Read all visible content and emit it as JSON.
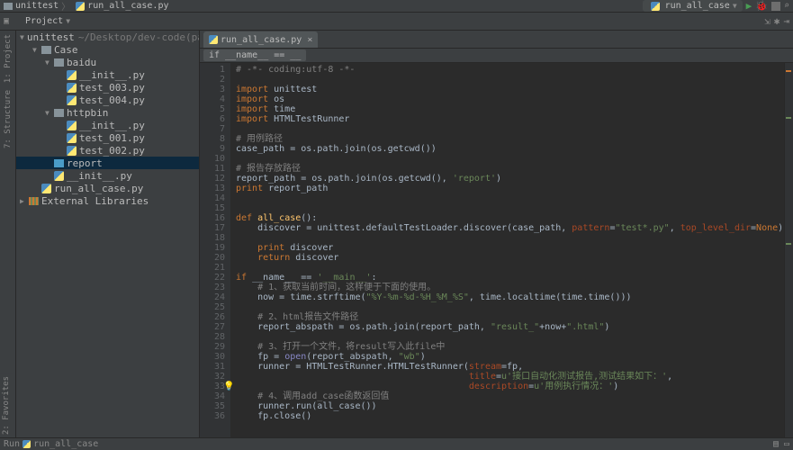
{
  "titlebar": {
    "project": "unittest",
    "file_icon": "python-icon",
    "filename": "run_all_case.py",
    "run_config": "run_all_case"
  },
  "toolbar": {
    "project_label": "Project"
  },
  "left_gutter": {
    "tabs": [
      "1: Project",
      "7: Structure"
    ]
  },
  "tree": {
    "root": {
      "name": "unittest",
      "path": "~/Desktop/dev-code(pa)/lear"
    },
    "items": [
      {
        "indent": 0,
        "arrow": "▼",
        "icon": "folder",
        "label": "unittest",
        "dim": "~/Desktop/dev-code(pa)/lear"
      },
      {
        "indent": 1,
        "arrow": "▼",
        "icon": "folder",
        "label": "Case"
      },
      {
        "indent": 2,
        "arrow": "▼",
        "icon": "folder",
        "label": "baidu"
      },
      {
        "indent": 3,
        "arrow": "",
        "icon": "py",
        "label": "__init__.py"
      },
      {
        "indent": 3,
        "arrow": "",
        "icon": "py",
        "label": "test_003.py"
      },
      {
        "indent": 3,
        "arrow": "",
        "icon": "py",
        "label": "test_004.py"
      },
      {
        "indent": 2,
        "arrow": "▼",
        "icon": "folder",
        "label": "httpbin"
      },
      {
        "indent": 3,
        "arrow": "",
        "icon": "py",
        "label": "__init__.py"
      },
      {
        "indent": 3,
        "arrow": "",
        "icon": "py",
        "label": "test_001.py"
      },
      {
        "indent": 3,
        "arrow": "",
        "icon": "py",
        "label": "test_002.py"
      },
      {
        "indent": 2,
        "arrow": "",
        "icon": "folder-report",
        "label": "report",
        "selected": true
      },
      {
        "indent": 2,
        "arrow": "",
        "icon": "py",
        "label": "__init__.py"
      },
      {
        "indent": 1,
        "arrow": "",
        "icon": "py",
        "label": "run_all_case.py"
      },
      {
        "indent": 0,
        "arrow": "▶",
        "icon": "lib",
        "label": "External Libraries"
      }
    ]
  },
  "editor": {
    "tab_label": "run_all_case.py",
    "breadcrumb": "if __name__ == __",
    "lines": [
      {
        "n": 1,
        "html": "<span class='cmt'># -*- coding:utf-8 -*-</span>"
      },
      {
        "n": 2,
        "html": ""
      },
      {
        "n": 3,
        "html": "<span class='kw'>import</span> unittest"
      },
      {
        "n": 4,
        "html": "<span class='kw'>import</span> os"
      },
      {
        "n": 5,
        "html": "<span class='kw'>import</span> time"
      },
      {
        "n": 6,
        "html": "<span class='kw'>import</span> HTMLTestRunner"
      },
      {
        "n": 7,
        "html": ""
      },
      {
        "n": 8,
        "html": "<span class='cmt'># 用例路径</span>"
      },
      {
        "n": 9,
        "html": "case_path = os.path.join(os.getcwd())"
      },
      {
        "n": 10,
        "html": ""
      },
      {
        "n": 11,
        "html": "<span class='cmt'># 报告存放路径</span>"
      },
      {
        "n": 12,
        "html": "report_path = os.path.join(os.getcwd(), <span class='str'>'report'</span>)"
      },
      {
        "n": 13,
        "html": "<span class='kw'>print</span> report_path"
      },
      {
        "n": 14,
        "html": ""
      },
      {
        "n": 15,
        "html": ""
      },
      {
        "n": 16,
        "html": "<span class='kw'>def </span><span class='fn'>all_case</span>():"
      },
      {
        "n": 17,
        "html": "    discover = unittest.defaultTestLoader.discover(case_path, <span class='param'>pattern</span>=<span class='str'>\"test*.py\"</span>, <span class='param'>top_level_dir</span>=<span class='kw'>None</span>)"
      },
      {
        "n": 18,
        "html": ""
      },
      {
        "n": 19,
        "html": "    <span class='kw'>print</span> discover"
      },
      {
        "n": 20,
        "html": "    <span class='kw'>return</span> discover"
      },
      {
        "n": 21,
        "html": ""
      },
      {
        "n": 22,
        "html": "<span class='kw'>if</span> __name__ == <span class='str'>'__main__'</span>:"
      },
      {
        "n": 23,
        "html": "    <span class='cmt'># 1、获取当前时间，这样便于下面的使用。</span>"
      },
      {
        "n": 24,
        "html": "    now = time.strftime(<span class='str'>\"%Y-%m-%d-%H_%M_%S\"</span>, time.localtime(time.time()))"
      },
      {
        "n": 25,
        "html": ""
      },
      {
        "n": 26,
        "html": "    <span class='cmt'># 2、html报告文件路径</span>"
      },
      {
        "n": 27,
        "html": "    report_abspath = os.path.join(report_path, <span class='str'>\"result_\"</span>+now+<span class='str'>\".html\"</span>)"
      },
      {
        "n": 28,
        "html": ""
      },
      {
        "n": 29,
        "html": "    <span class='cmt'># 3、打开一个文件，将result写入此file中</span>"
      },
      {
        "n": 30,
        "html": "    fp = <span class='builtin'>open</span>(report_abspath, <span class='str'>\"wb\"</span>)"
      },
      {
        "n": 31,
        "html": "    runner = HTMLTestRunner.HTMLTestRunner(<span class='param'>stream</span>=fp,"
      },
      {
        "n": 32,
        "html": "                                           <span class='param'>title</span>=<span class='str'>u'接口自动化测试报告,测试结果如下：'</span>,"
      },
      {
        "n": 33,
        "html": "                                           <span class='param'>description</span>=<span class='str'>u'用例执行情况：'</span>)"
      },
      {
        "n": 34,
        "html": "    <span class='cmt'># 4、调用add_case函数返回值</span>"
      },
      {
        "n": 35,
        "html": "    runner.run(all_case())"
      },
      {
        "n": 36,
        "html": "    fp.close()"
      }
    ]
  },
  "statusbar": {
    "run_label": "Run",
    "run_target": "run_all_case",
    "favorites": "2: Favorites"
  }
}
